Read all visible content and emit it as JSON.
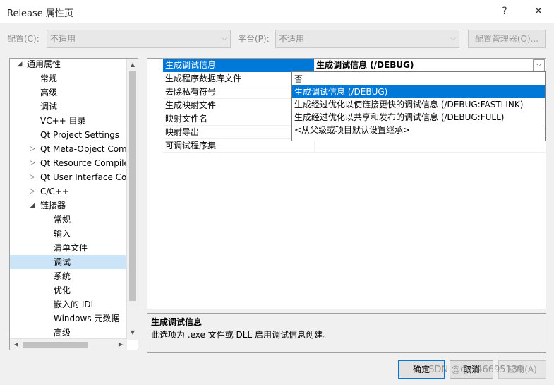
{
  "window": {
    "title": "Release 属性页",
    "help_icon": "?",
    "close_icon": "✕"
  },
  "toolbar": {
    "config_label": "配置(C):",
    "config_value": "不适用",
    "platform_label": "平台(P):",
    "platform_value": "不适用",
    "config_manager_label": "配置管理器(O)..."
  },
  "tree": {
    "items": [
      {
        "label": "通用属性",
        "expander": "◢"
      },
      {
        "label": "常规",
        "expander": ""
      },
      {
        "label": "高级",
        "expander": ""
      },
      {
        "label": "调试",
        "expander": ""
      },
      {
        "label": "VC++ 目录",
        "expander": ""
      },
      {
        "label": "Qt Project Settings",
        "expander": ""
      },
      {
        "label": "Qt Meta-Object Com",
        "expander": "▷"
      },
      {
        "label": "Qt Resource Compile",
        "expander": "▷"
      },
      {
        "label": "Qt User Interface Coi",
        "expander": "▷"
      },
      {
        "label": "C/C++",
        "expander": "▷"
      },
      {
        "label": "链接器",
        "expander": "◢"
      },
      {
        "label": "常规",
        "expander": ""
      },
      {
        "label": "输入",
        "expander": ""
      },
      {
        "label": "清单文件",
        "expander": ""
      },
      {
        "label": "调试",
        "expander": "",
        "selected": true
      },
      {
        "label": "系统",
        "expander": ""
      },
      {
        "label": "优化",
        "expander": ""
      },
      {
        "label": "嵌入的 IDL",
        "expander": ""
      },
      {
        "label": "Windows 元数据",
        "expander": ""
      },
      {
        "label": "高级",
        "expander": ""
      }
    ]
  },
  "properties": {
    "rows": [
      {
        "name": "生成调试信息",
        "value": "生成调试信息 (/DEBUG)"
      },
      {
        "name": "生成程序数据库文件",
        "value": ""
      },
      {
        "name": "去除私有符号",
        "value": ""
      },
      {
        "name": "生成映射文件",
        "value": ""
      },
      {
        "name": "映射文件名",
        "value": ""
      },
      {
        "name": "映射导出",
        "value": ""
      },
      {
        "name": "可调试程序集",
        "value": ""
      }
    ]
  },
  "dropdown": {
    "options": [
      "否",
      "生成调试信息 (/DEBUG)",
      "生成经过优化以使链接更快的调试信息 (/DEBUG:FASTLINK)",
      "生成经过优化以共享和发布的调试信息 (/DEBUG:FULL)",
      "<从父级或项目默认设置继承>"
    ],
    "selected_index": 1
  },
  "description": {
    "title": "生成调试信息",
    "text": "此选项为 .exe 文件或 DLL 启用调试信息创建。"
  },
  "buttons": {
    "ok": "确定",
    "cancel": "取消",
    "apply": "应用(A)"
  },
  "watermark": "CSDN @qq_46695139"
}
